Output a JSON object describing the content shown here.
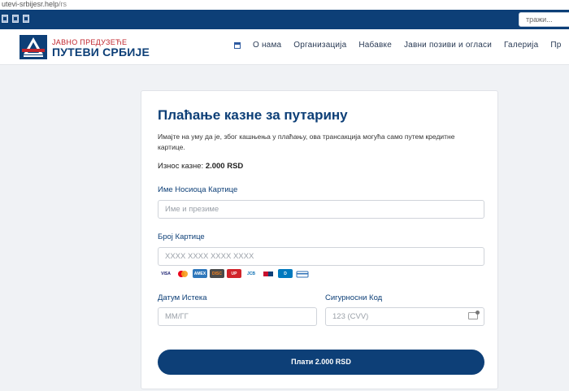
{
  "browser": {
    "url_main": "utevi-srbijesr.help",
    "url_path": "/rs"
  },
  "top_bar": {
    "search_placeholder": "тражи..."
  },
  "brand": {
    "line1": "ЈАВНО ПРЕДУЗЕЋЕ",
    "line2": "ПУТЕВИ СРБИЈЕ"
  },
  "nav": {
    "items": [
      "О нама",
      "Организација",
      "Набавке",
      "Јавни позиви и огласи",
      "Галерија",
      "Пр"
    ]
  },
  "payment": {
    "title": "Плаћање казне за путарину",
    "notice": "Имајте на уму да је, због кашњења у плаћању, ова трансакција могућа само путем кредитне картице.",
    "amount_label": "Износ казне:",
    "amount_value": "2.000 RSD",
    "name_label": "Име Носиоца Картице",
    "name_placeholder": "Име и презиме",
    "card_label": "Број Картице",
    "card_placeholder": "XXXX XXXX XXXX XXXX",
    "expiry_label": "Датум Истека",
    "expiry_placeholder": "ММ/ГГ",
    "cvv_label": "Сигурносни Код",
    "cvv_placeholder": "123 (CVV)",
    "pay_button": "Плати 2.000 RSD",
    "card_brands": [
      {
        "name": "visa-icon",
        "text": "VISA",
        "color": "#ffffff",
        "fg": "#1a1f71"
      },
      {
        "name": "mastercard-icon",
        "text": "",
        "color": "#ffffff",
        "fg": "#eb001b"
      },
      {
        "name": "amex-icon",
        "text": "AMEX",
        "color": "#2e77bb",
        "fg": "#ffffff"
      },
      {
        "name": "discover-icon",
        "text": "DISC",
        "color": "#4a4a4a",
        "fg": "#f58220"
      },
      {
        "name": "unionpay-icon",
        "text": "UP",
        "color": "#d1232a",
        "fg": "#ffffff"
      },
      {
        "name": "jcb-icon",
        "text": "JCB",
        "color": "#ffffff",
        "fg": "#0b6eb3"
      },
      {
        "name": "dinacard-icon",
        "text": "",
        "color": "#ffffff",
        "fg": "#c8102e"
      },
      {
        "name": "diners-icon",
        "text": "D",
        "color": "#0079be",
        "fg": "#ffffff"
      },
      {
        "name": "generic-card-icon",
        "text": "",
        "color": "#ffffff",
        "fg": "#2d6fb5"
      }
    ]
  }
}
